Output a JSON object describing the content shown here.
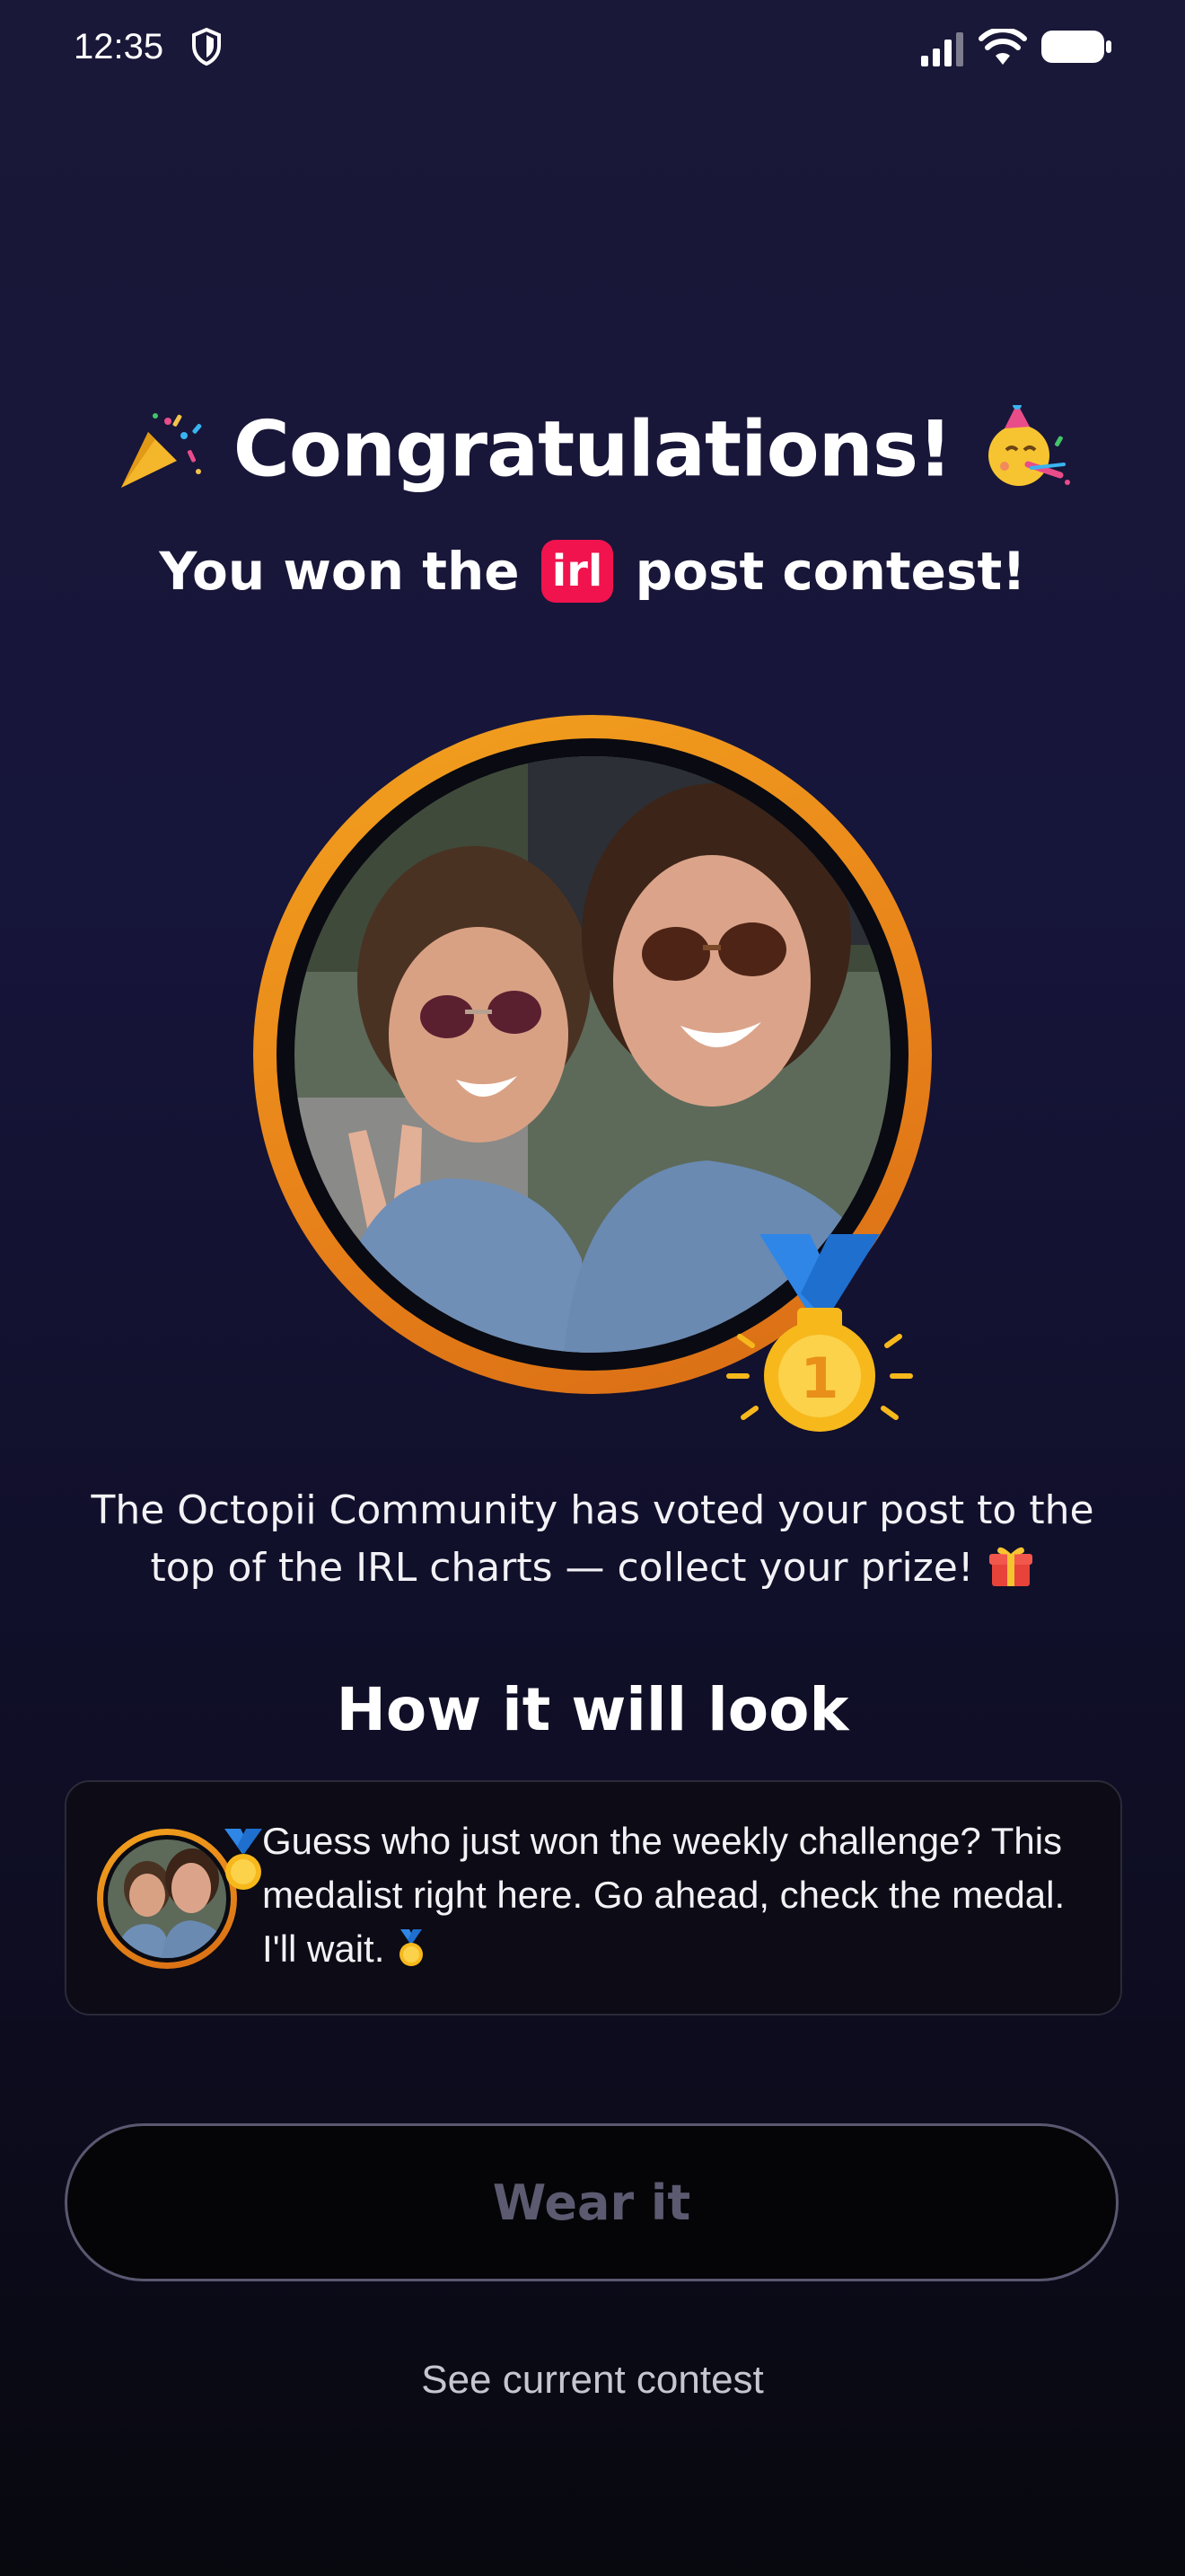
{
  "status_bar": {
    "time": "12:35"
  },
  "header": {
    "title": "Congratulations!",
    "subtitle_before": "You won the",
    "subtitle_badge": "irl",
    "subtitle_after": "post contest!"
  },
  "description": "The Octopii Community has voted your post to the top of the IRL charts — collect your prize!",
  "medal_number": "1",
  "preview": {
    "heading": "How it will look",
    "text": "Guess who just won the weekly challenge? This medalist right here. Go ahead, check the medal. I'll wait."
  },
  "actions": {
    "wear_label": "Wear it",
    "see_contest_label": "See current contest"
  },
  "colors": {
    "ring_orange": "#e8821a",
    "badge_pink": "#f0134d",
    "medal_gold": "#f7b81c",
    "ribbon_blue": "#2f86e6",
    "background": "#16153a"
  },
  "icons": {
    "shield": "shield-icon",
    "signal": "cellular-signal-icon",
    "wifi": "wifi-icon",
    "battery": "battery-icon",
    "party_popper": "party-popper-icon",
    "party_face": "party-face-icon",
    "gift": "gift-icon",
    "medal": "gold-medal-icon"
  }
}
